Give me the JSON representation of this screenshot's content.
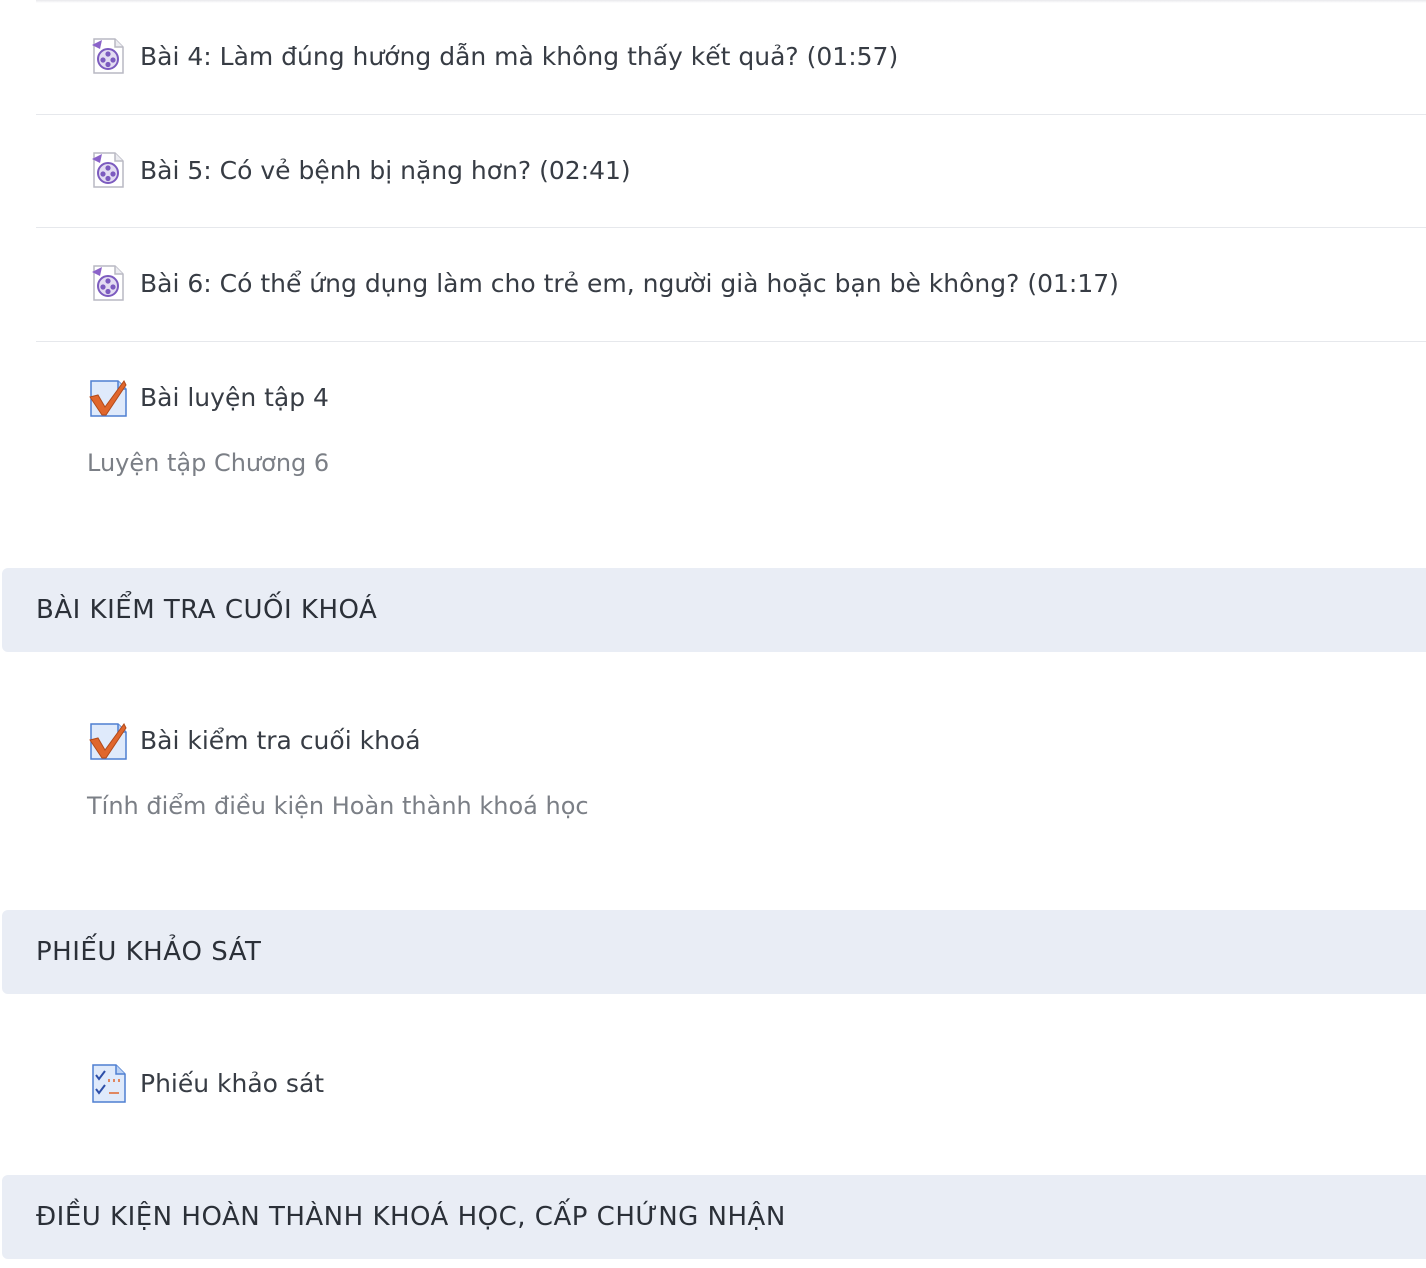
{
  "activities": [
    {
      "title": "Bài 4: Làm đúng hướng dẫn mà không thấy kết quả? (01:57)",
      "icon": "video-file-icon"
    },
    {
      "title": "Bài 5: Có vẻ bệnh bị nặng hơn? (02:41)",
      "icon": "video-file-icon"
    },
    {
      "title": "Bài 6: Có thể ứng dụng làm cho trẻ em, người già hoặc bạn bè không? (01:17)",
      "icon": "video-file-icon"
    },
    {
      "title": "Bài luyện tập 4",
      "description": "Luyện tập Chương 6",
      "icon": "quiz-check-icon"
    }
  ],
  "sections": [
    {
      "title": "BÀI KIỂM TRA CUỐI KHOÁ",
      "activity": {
        "title": "Bài kiểm tra cuối khoá",
        "description": "Tính điểm điều kiện Hoàn thành khoá học",
        "icon": "quiz-check-icon"
      }
    },
    {
      "title": "PHIẾU KHẢO SÁT",
      "activity": {
        "title": "Phiếu khảo sát",
        "icon": "survey-icon"
      }
    },
    {
      "title": "ĐIỀU KIỆN HOÀN THÀNH KHOÁ HỌC, CẤP CHỨNG NHẬN"
    }
  ],
  "colors": {
    "section_bg": "#e9edf5",
    "video_icon": "#8a62c9",
    "check_mark": "#e0662c"
  }
}
